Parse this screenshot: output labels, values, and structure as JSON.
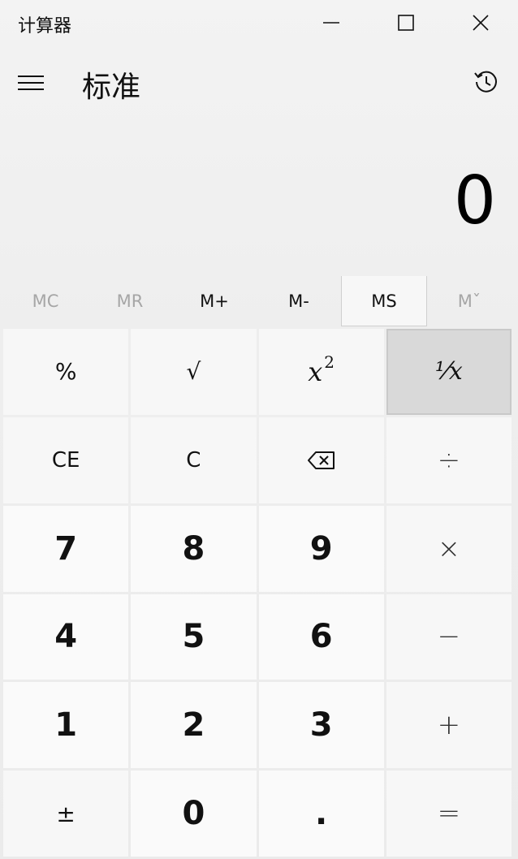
{
  "window": {
    "title": "计算器"
  },
  "header": {
    "mode_title": "标准"
  },
  "display": {
    "value": "0"
  },
  "memory": [
    {
      "label": "MC",
      "enabled": false
    },
    {
      "label": "MR",
      "enabled": false
    },
    {
      "label": "M+",
      "enabled": true
    },
    {
      "label": "M-",
      "enabled": true
    },
    {
      "label": "MS",
      "enabled": true
    },
    {
      "label": "Mˇ",
      "enabled": false
    }
  ],
  "keys": {
    "percent": "%",
    "sqrt": "√",
    "square_base": "x",
    "square_exp": "2",
    "reciprocal": "⅟x",
    "ce": "CE",
    "c": "C",
    "divide": "÷",
    "seven": "7",
    "eight": "8",
    "nine": "9",
    "multiply": "×",
    "four": "4",
    "five": "5",
    "six": "6",
    "minus": "−",
    "one": "1",
    "two": "2",
    "three": "3",
    "plus": "+",
    "negate": "±",
    "zero": "0",
    "decimal": ".",
    "equals": "="
  },
  "icons": {
    "minimize": "minimize-icon",
    "maximize": "maximize-icon",
    "close": "close-icon",
    "menu": "hamburger-icon",
    "history": "history-icon",
    "backspace": "backspace-icon"
  },
  "colors": {
    "background": "#ebebeb",
    "key_light": "#f7f7f7",
    "key_digit": "#fafafa",
    "key_hover": "#d9d9d9",
    "disabled_text": "#a6a6a6"
  }
}
